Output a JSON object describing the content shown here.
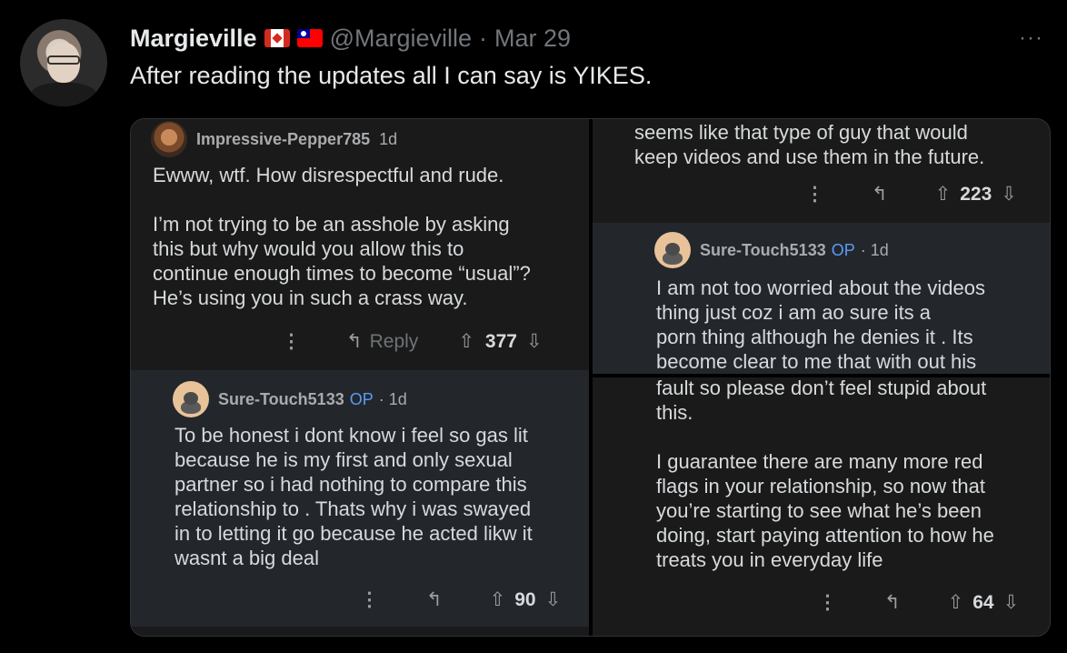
{
  "tweet": {
    "author_name": "Margieville",
    "handle": "@Margieville",
    "separator": "·",
    "date": "Mar 29",
    "text": "After reading the updates all I can say is YIKES.",
    "more_label": "···",
    "flags": [
      "canada-flag",
      "taiwan-flag"
    ]
  },
  "screenshot_left": {
    "comment": {
      "username": "Impressive-Pepper785",
      "age": "1d",
      "body": "Ewww, wtf. How disrespectful and rude.\n\nI’m not trying to be an asshole by asking\nthis but why would you allow this to\ncontinue enough times to become “usual”?\nHe’s using you in such a crass way.",
      "reply_label": "Reply",
      "votes": "377"
    },
    "reply": {
      "username": "Sure-Touch5133",
      "op_badge": "OP",
      "age": "· 1d",
      "body": "To be honest i dont know i feel so gas lit\nbecause he is my first and only sexual\npartner so i had nothing to compare this\nrelationship to . Thats why i was swayed\nin to letting it go because he acted likw it\nwasnt a big deal",
      "votes": "90"
    }
  },
  "screenshot_right": {
    "top_comment": {
      "body": "seems like that type of guy that would\nkeep videos and use them in the future.",
      "votes": "223"
    },
    "reply": {
      "username": "Sure-Touch5133",
      "op_badge": "OP",
      "age": "· 1d",
      "body": "I am not too worried about the videos\nthing just coz i am ao sure its a\nporn thing although he denies it . Its\nbecome clear to me that with out his"
    },
    "bottom_comment": {
      "body": "fault so please don’t feel stupid about\nthis.\n\nI guarantee there are many more red\nflags in your relationship, so now that\nyou’re starting to see what he’s been\ndoing, start paying attention to how he\ntreats you in everyday life",
      "votes": "64"
    }
  },
  "icons": {
    "dots": "⋮",
    "reply_arrow": "↰",
    "upvote": "⇧",
    "downvote": "⇩"
  }
}
